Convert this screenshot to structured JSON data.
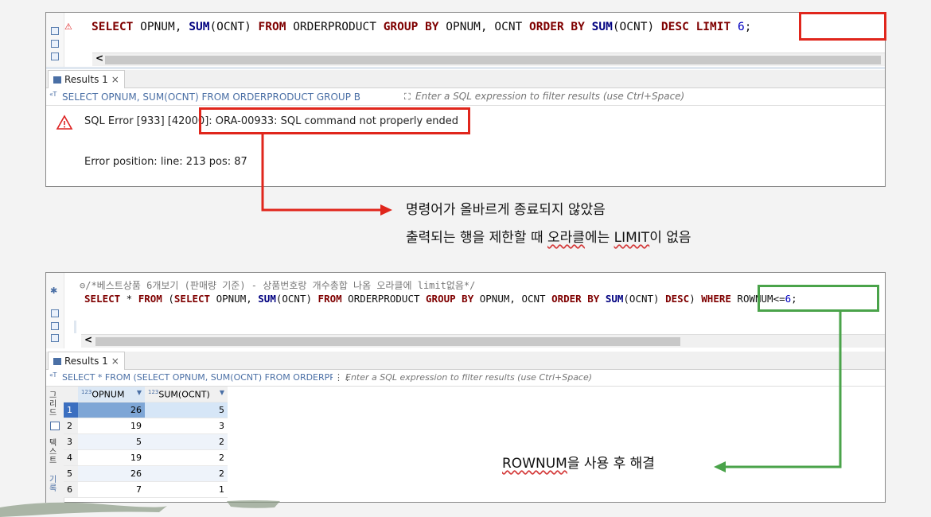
{
  "top_panel": {
    "sql_line": {
      "parts": [
        {
          "t": "SELECT",
          "c": "kw2"
        },
        {
          "t": " OPNUM, ",
          "c": ""
        },
        {
          "t": "SUM",
          "c": "fn"
        },
        {
          "t": "(OCNT) ",
          "c": ""
        },
        {
          "t": "FROM",
          "c": "kw2"
        },
        {
          "t": " ORDERPRODUCT ",
          "c": ""
        },
        {
          "t": "GROUP BY",
          "c": "kw2"
        },
        {
          "t": " OPNUM, OCNT ",
          "c": ""
        },
        {
          "t": "ORDER BY",
          "c": "kw2"
        },
        {
          "t": " ",
          "c": ""
        },
        {
          "t": "SUM",
          "c": "fn"
        },
        {
          "t": "(OCNT) ",
          "c": ""
        },
        {
          "t": "DESC",
          "c": "kw2"
        },
        {
          "t": " ",
          "c": ""
        },
        {
          "t": "LIMIT",
          "c": "kw2"
        },
        {
          "t": " ",
          "c": ""
        },
        {
          "t": "6",
          "c": "num"
        },
        {
          "t": ";",
          "c": ""
        }
      ]
    },
    "results_tab": "Results 1",
    "results_tab_close": "×",
    "filter_query": "SELECT OPNUM, SUM(OCNT) FROM ORDERPRODUCT GROUP B",
    "filter_placeholder": "Enter a SQL expression to filter results (use Ctrl+Space)",
    "error_text": "SQL Error [933] [42000]: ORA-00933: SQL command not properly ended",
    "error_position": "Error position: line: 213 pos: 87",
    "scroll_left": "<"
  },
  "annotation1": {
    "line1": "명령어가 올바르게 종료되지 않았음",
    "line2_pre": "출력되는 행을 제한할 때 ",
    "line2_ul1": "오라클",
    "line2_mid": "에는 ",
    "line2_ul2": "LIMIT",
    "line2_post": "이 없음"
  },
  "bottom_panel": {
    "comment": "/*베스트상품 6개보기 (판매량 기준) - 상품번호랑 개수총합 나옴 오라클에 limit없음*/",
    "sql_parts": [
      {
        "t": "SELECT",
        "c": "kw2"
      },
      {
        "t": " * ",
        "c": ""
      },
      {
        "t": "FROM",
        "c": "kw2"
      },
      {
        "t": " (",
        "c": ""
      },
      {
        "t": "SELECT",
        "c": "kw2"
      },
      {
        "t": " OPNUM, ",
        "c": ""
      },
      {
        "t": "SUM",
        "c": "fn"
      },
      {
        "t": "(OCNT) ",
        "c": ""
      },
      {
        "t": "FROM",
        "c": "kw2"
      },
      {
        "t": " ORDERPRODUCT ",
        "c": ""
      },
      {
        "t": "GROUP BY",
        "c": "kw2"
      },
      {
        "t": " OPNUM, OCNT ",
        "c": ""
      },
      {
        "t": "ORDER BY",
        "c": "kw2"
      },
      {
        "t": " ",
        "c": ""
      },
      {
        "t": "SUM",
        "c": "fn"
      },
      {
        "t": "(OCNT) ",
        "c": ""
      },
      {
        "t": "DESC",
        "c": "kw2"
      },
      {
        "t": ") ",
        "c": ""
      },
      {
        "t": "WHERE",
        "c": "kw2"
      },
      {
        "t": " ROWNUM<=",
        "c": ""
      },
      {
        "t": "6",
        "c": "num"
      },
      {
        "t": ";",
        "c": ""
      }
    ],
    "results_tab": "Results 1",
    "results_tab_close": "×",
    "filter_query": "SELECT * FROM (SELECT OPNUM, SUM(OCNT) FROM ORDERPR",
    "filter_placeholder": "Enter a SQL expression to filter results (use Ctrl+Space)",
    "scroll_left": "<",
    "side_tabs": [
      "그리드",
      "텍스트",
      "기록"
    ],
    "columns": [
      {
        "type": "123",
        "name": "OPNUM"
      },
      {
        "type": "123",
        "name": "SUM(OCNT)"
      }
    ],
    "rows": [
      {
        "n": "1",
        "opnum": "26",
        "sum": "5"
      },
      {
        "n": "2",
        "opnum": "19",
        "sum": "3"
      },
      {
        "n": "3",
        "opnum": "5",
        "sum": "2"
      },
      {
        "n": "4",
        "opnum": "19",
        "sum": "2"
      },
      {
        "n": "5",
        "opnum": "26",
        "sum": "2"
      },
      {
        "n": "6",
        "opnum": "7",
        "sum": "1"
      }
    ]
  },
  "annotation2": {
    "ul": "ROWNUM",
    "rest": "을 사용 후 해결"
  },
  "colors": {
    "red_highlight": "#e0261c",
    "green_highlight": "#4aa34a",
    "keyword": "#7f0000",
    "function": "#000080",
    "number": "#0000c0"
  }
}
